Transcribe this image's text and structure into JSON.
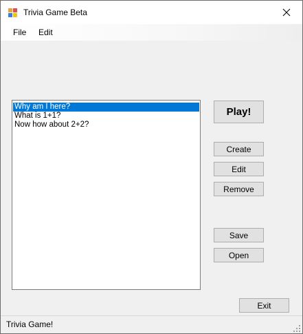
{
  "window": {
    "title": "Trivia Game Beta",
    "icon": "app-icon",
    "close_icon": "close-icon"
  },
  "menu": {
    "items": [
      "File",
      "Edit"
    ]
  },
  "questions": {
    "items": [
      {
        "text": "Why am I here?",
        "selected": true
      },
      {
        "text": "What is 1+1?",
        "selected": false
      },
      {
        "text": "Now how about 2+2?",
        "selected": false
      }
    ]
  },
  "buttons": {
    "play": "Play!",
    "create": "Create",
    "edit": "Edit",
    "remove": "Remove",
    "save": "Save",
    "open": "Open",
    "exit": "Exit"
  },
  "status": {
    "text": "Trivia Game!"
  },
  "colors": {
    "selection": "#0078d7",
    "window_bg": "#f0f0f0",
    "button_bg": "#e1e1e1"
  }
}
